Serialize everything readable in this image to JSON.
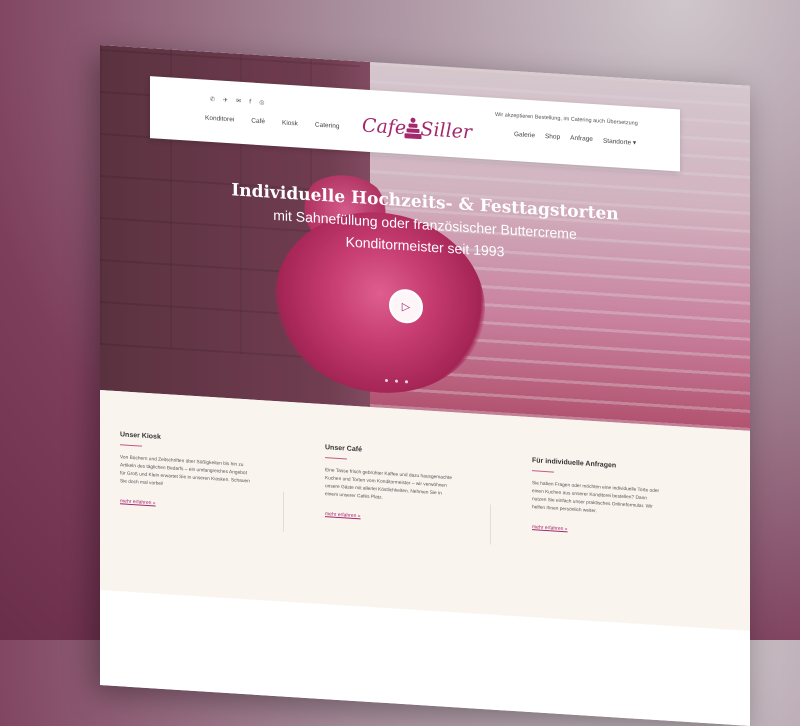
{
  "social": [
    "✆",
    "✈",
    "✉",
    "f",
    "◎"
  ],
  "nav_left": [
    "Konditorei",
    "Café",
    "Kiosk",
    "Catering"
  ],
  "logo": {
    "left": "Cafe",
    "right": "Siller"
  },
  "notice": "Wir akzeptieren Bestellung, im Catering auch Übersetzung",
  "nav_right": [
    "Galerie",
    "Shop",
    "Anfrage",
    "Standorte ▾"
  ],
  "hero": {
    "title": "Individuelle Hochzeits- & Festtagstorten",
    "subtitle1": "mit Sahnefüllung oder französischer Buttercreme",
    "subtitle2": "Konditormeister seit 1993",
    "play_icon": "▷"
  },
  "columns": [
    {
      "title": "Unser Kiosk",
      "text": "Von Büchern und Zeitschriften über Süßigkeiten bis hin zu Artikeln des täglichen Bedarfs – ein umfangreiches Angebot für Groß und Klein erwartet Sie in unseren Kiosken. Schauen Sie doch mal vorbei!",
      "link": "mehr erfahren  »"
    },
    {
      "title": "Unser Café",
      "text": "Eine Tasse frisch gebrühter Kaffee und dazu hausgemachte Kuchen und Torten vom Konditormeister – wir verwöhnen unsere Gäste mit allerlei Köstlichkeiten. Nehmen Sie in einem unserer Cafés Platz.",
      "link": "mehr erfahren  »"
    },
    {
      "title": "Für individuelle Anfragen",
      "text": "Sie haben Fragen oder möchten eine individuelle Torte oder einen Kuchen aus unserer Konditorei bestellen? Dann nutzen Sie einfach unser praktisches Onlineformular. Wir helfen Ihnen persönlich weiter.",
      "link": "mehr erfahren  »"
    }
  ],
  "colors": {
    "brand": "#a3286d",
    "accent": "#c35a86"
  }
}
